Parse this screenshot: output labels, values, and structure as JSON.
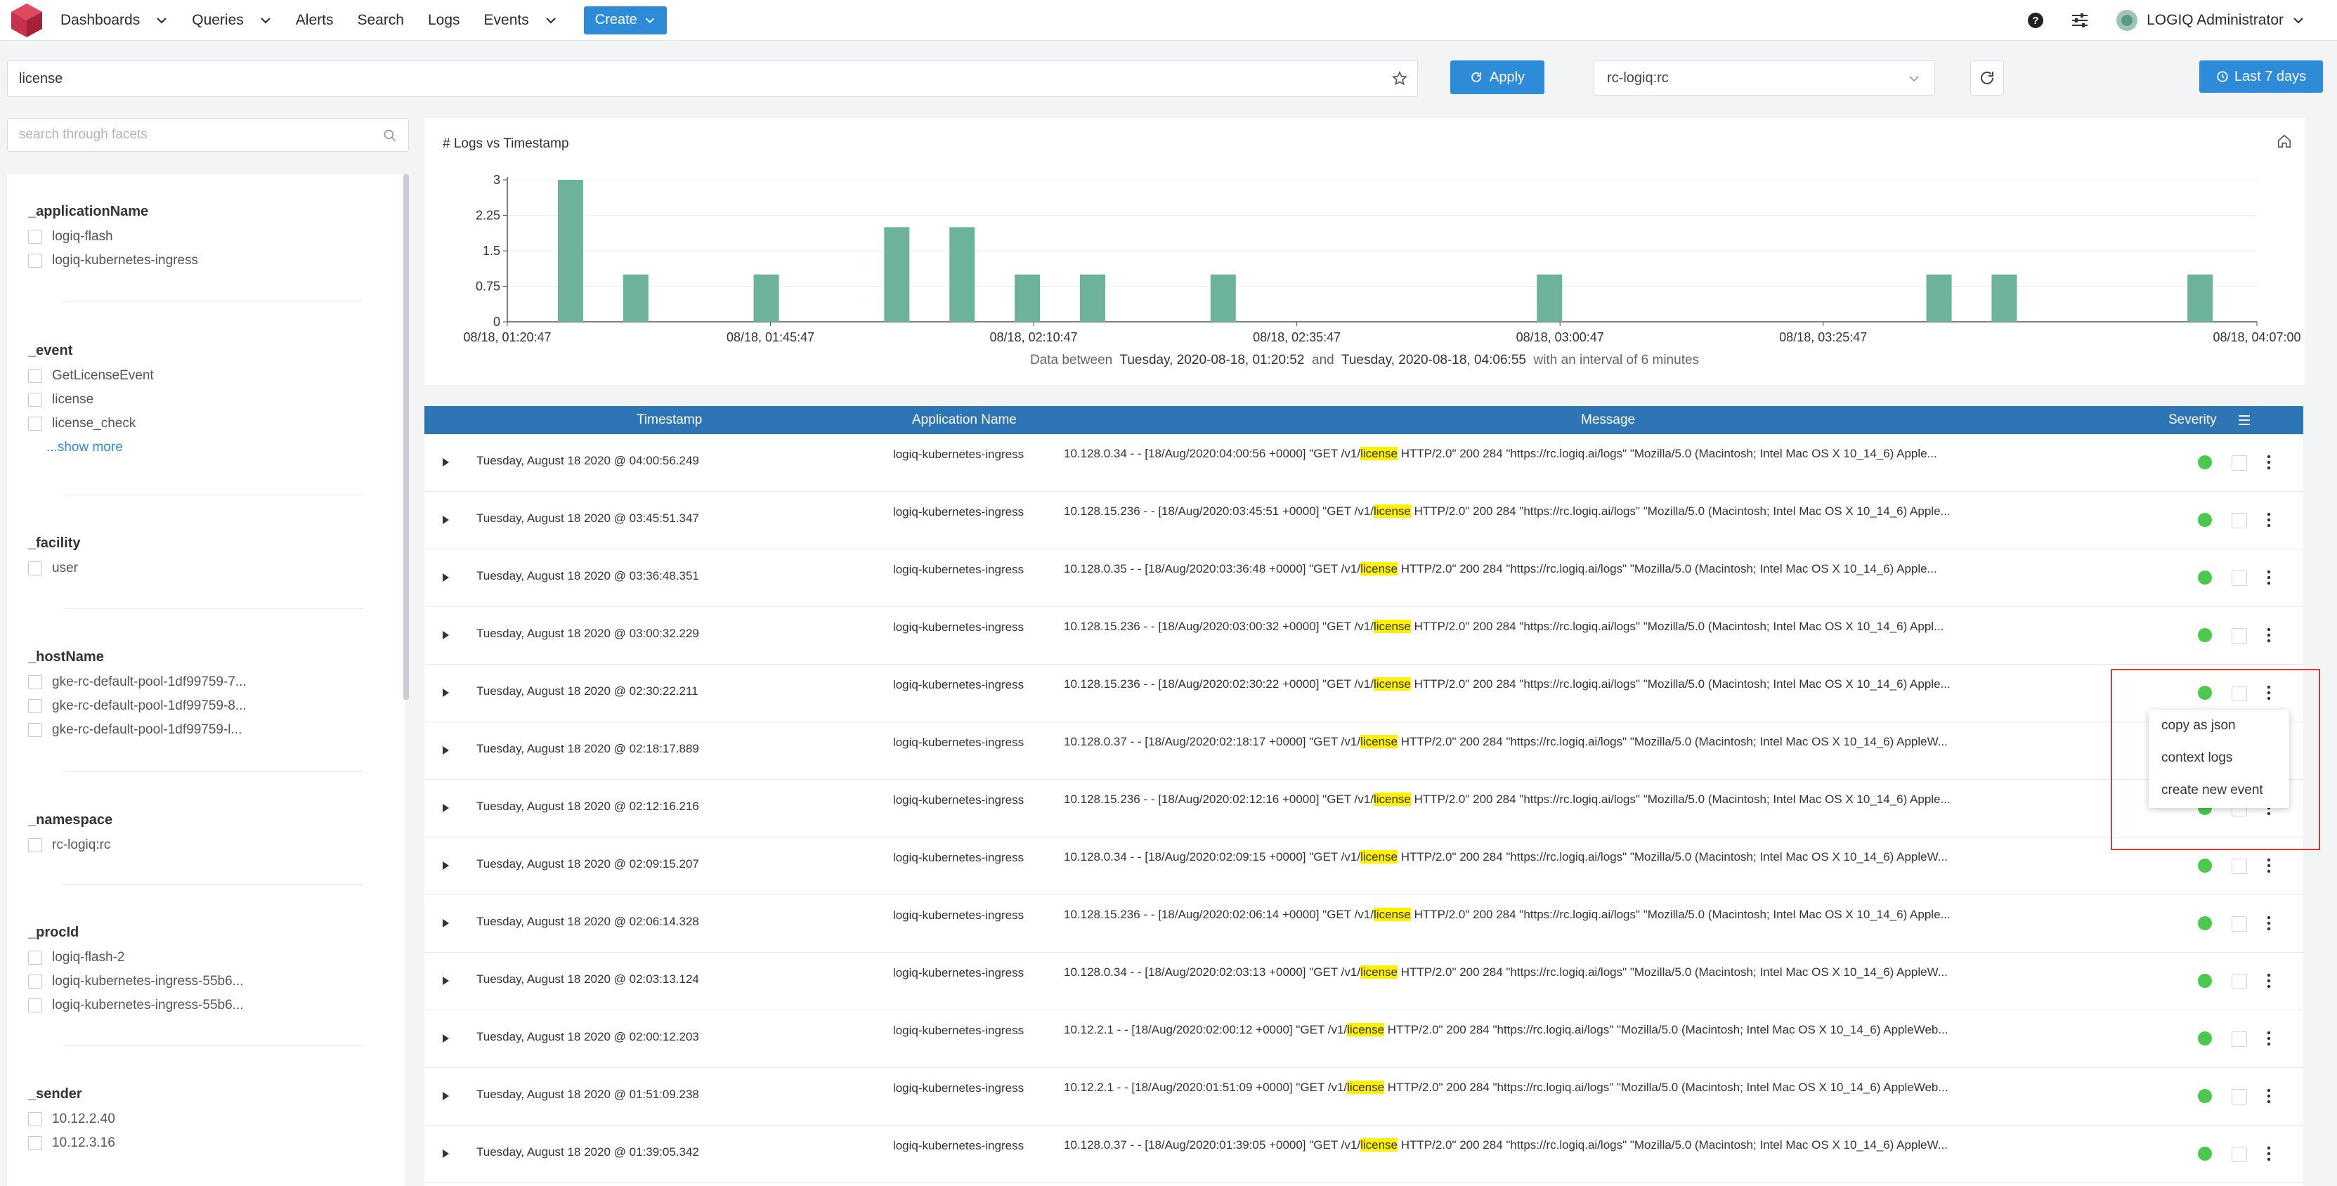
{
  "nav": {
    "items": [
      "Dashboards",
      "Queries",
      "Alerts",
      "Search",
      "Logs",
      "Events"
    ],
    "create_label": "Create",
    "user_label": "LOGIQ Administrator"
  },
  "query": {
    "text": "license",
    "apply_label": "Apply",
    "namespace": "rc-logiq:rc",
    "time_range": "Last 7 days"
  },
  "facets": {
    "search_placeholder": "search through facets",
    "groups": [
      {
        "title": "_applicationName",
        "options": [
          "logiq-flash",
          "logiq-kubernetes-ingress"
        ]
      },
      {
        "title": "_event",
        "options": [
          "GetLicenseEvent",
          "license",
          "license_check"
        ],
        "more": "...show more"
      },
      {
        "title": "_facility",
        "options": [
          "user"
        ]
      },
      {
        "title": "_hostName",
        "options": [
          "gke-rc-default-pool-1df99759-7...",
          "gke-rc-default-pool-1df99759-8...",
          "gke-rc-default-pool-1df99759-l..."
        ]
      },
      {
        "title": "_namespace",
        "options": [
          "rc-logiq:rc"
        ]
      },
      {
        "title": "_procId",
        "options": [
          "logiq-flash-2",
          "logiq-kubernetes-ingress-55b6...",
          "logiq-kubernetes-ingress-55b6..."
        ]
      },
      {
        "title": "_sender",
        "options": [
          "10.12.2.40",
          "10.12.3.16"
        ]
      }
    ]
  },
  "chart_data": {
    "type": "bar",
    "title": "# Logs vs Timestamp",
    "y_ticks": [
      "3",
      "2.25",
      "1.5",
      "0.75",
      "0"
    ],
    "ylim": [
      0,
      3
    ],
    "x_ticks": [
      "08/18, 01:20:47",
      "08/18, 01:45:47",
      "08/18, 02:10:47",
      "08/18, 02:35:47",
      "08/18, 03:00:47",
      "08/18, 03:25:47",
      "08/18, 04:07:00"
    ],
    "x_tick_minutes": [
      0,
      25,
      50,
      75,
      100,
      125,
      166.2
    ],
    "bars": [
      {
        "minute": 6,
        "value": 3
      },
      {
        "minute": 12.2,
        "value": 1
      },
      {
        "minute": 24.6,
        "value": 1
      },
      {
        "minute": 37,
        "value": 2
      },
      {
        "minute": 43.2,
        "value": 2
      },
      {
        "minute": 49.4,
        "value": 1
      },
      {
        "minute": 55.6,
        "value": 1
      },
      {
        "minute": 68,
        "value": 1
      },
      {
        "minute": 99,
        "value": 1
      },
      {
        "minute": 136,
        "value": 1
      },
      {
        "minute": 142.2,
        "value": 1
      },
      {
        "minute": 160.8,
        "value": 1
      }
    ],
    "caption_prefix": "Data between",
    "caption_start": "Tuesday, 2020-08-18, 01:20:52",
    "caption_and": "and",
    "caption_end": "Tuesday, 2020-08-18, 04:06:55",
    "caption_suffix": "with an interval of 6 minutes"
  },
  "table": {
    "headers": {
      "timestamp": "Timestamp",
      "app": "Application Name",
      "message": "Message",
      "severity": "Severity"
    },
    "highlight": "license",
    "rows": [
      {
        "ts": "Tuesday, August 18 2020 @ 04:00:56.249",
        "app": "logiq-kubernetes-ingress",
        "pre": "10.128.0.34 - - [18/Aug/2020:04:00:56 +0000] \"GET /v1/",
        "post": " HTTP/2.0\" 200 284 \"https://rc.logiq.ai/logs\" \"Mozilla/5.0 (Macintosh; Intel Mac OS X 10_14_6) Apple..."
      },
      {
        "ts": "Tuesday, August 18 2020 @ 03:45:51.347",
        "app": "logiq-kubernetes-ingress",
        "pre": "10.128.15.236 - - [18/Aug/2020:03:45:51 +0000] \"GET /v1/",
        "post": " HTTP/2.0\" 200 284 \"https://rc.logiq.ai/logs\" \"Mozilla/5.0 (Macintosh; Intel Mac OS X 10_14_6) Apple..."
      },
      {
        "ts": "Tuesday, August 18 2020 @ 03:36:48.351",
        "app": "logiq-kubernetes-ingress",
        "pre": "10.128.0.35 - - [18/Aug/2020:03:36:48 +0000] \"GET /v1/",
        "post": " HTTP/2.0\" 200 284 \"https://rc.logiq.ai/logs\" \"Mozilla/5.0 (Macintosh; Intel Mac OS X 10_14_6) Apple..."
      },
      {
        "ts": "Tuesday, August 18 2020 @ 03:00:32.229",
        "app": "logiq-kubernetes-ingress",
        "pre": "10.128.15.236 - - [18/Aug/2020:03:00:32 +0000] \"GET /v1/",
        "post": " HTTP/2.0\" 200 284 \"https://rc.logiq.ai/logs\" \"Mozilla/5.0 (Macintosh; Intel Mac OS X 10_14_6) Appl..."
      },
      {
        "ts": "Tuesday, August 18 2020 @ 02:30:22.211",
        "app": "logiq-kubernetes-ingress",
        "pre": "10.128.15.236 - - [18/Aug/2020:02:30:22 +0000] \"GET /v1/",
        "post": " HTTP/2.0\" 200 284 \"https://rc.logiq.ai/logs\" \"Mozilla/5.0 (Macintosh; Intel Mac OS X 10_14_6) Apple..."
      },
      {
        "ts": "Tuesday, August 18 2020 @ 02:18:17.889",
        "app": "logiq-kubernetes-ingress",
        "pre": "10.128.0.37 - - [18/Aug/2020:02:18:17 +0000] \"GET /v1/",
        "post": " HTTP/2.0\" 200 284 \"https://rc.logiq.ai/logs\" \"Mozilla/5.0 (Macintosh; Intel Mac OS X 10_14_6) AppleW..."
      },
      {
        "ts": "Tuesday, August 18 2020 @ 02:12:16.216",
        "app": "logiq-kubernetes-ingress",
        "pre": "10.128.15.236 - - [18/Aug/2020:02:12:16 +0000] \"GET /v1/",
        "post": " HTTP/2.0\" 200 284 \"https://rc.logiq.ai/logs\" \"Mozilla/5.0 (Macintosh; Intel Mac OS X 10_14_6) Apple..."
      },
      {
        "ts": "Tuesday, August 18 2020 @ 02:09:15.207",
        "app": "logiq-kubernetes-ingress",
        "pre": "10.128.0.34 - - [18/Aug/2020:02:09:15 +0000] \"GET /v1/",
        "post": " HTTP/2.0\" 200 284 \"https://rc.logiq.ai/logs\" \"Mozilla/5.0 (Macintosh; Intel Mac OS X 10_14_6) AppleW..."
      },
      {
        "ts": "Tuesday, August 18 2020 @ 02:06:14.328",
        "app": "logiq-kubernetes-ingress",
        "pre": "10.128.15.236 - - [18/Aug/2020:02:06:14 +0000] \"GET /v1/",
        "post": " HTTP/2.0\" 200 284 \"https://rc.logiq.ai/logs\" \"Mozilla/5.0 (Macintosh; Intel Mac OS X 10_14_6) Apple..."
      },
      {
        "ts": "Tuesday, August 18 2020 @ 02:03:13.124",
        "app": "logiq-kubernetes-ingress",
        "pre": "10.128.0.34 - - [18/Aug/2020:02:03:13 +0000] \"GET /v1/",
        "post": " HTTP/2.0\" 200 284 \"https://rc.logiq.ai/logs\" \"Mozilla/5.0 (Macintosh; Intel Mac OS X 10_14_6) AppleW..."
      },
      {
        "ts": "Tuesday, August 18 2020 @ 02:00:12.203",
        "app": "logiq-kubernetes-ingress",
        "pre": "10.12.2.1 - - [18/Aug/2020:02:00:12 +0000] \"GET /v1/",
        "post": " HTTP/2.0\" 200 284 \"https://rc.logiq.ai/logs\" \"Mozilla/5.0 (Macintosh; Intel Mac OS X 10_14_6) AppleWeb..."
      },
      {
        "ts": "Tuesday, August 18 2020 @ 01:51:09.238",
        "app": "logiq-kubernetes-ingress",
        "pre": "10.12.2.1 - - [18/Aug/2020:01:51:09 +0000] \"GET /v1/",
        "post": " HTTP/2.0\" 200 284 \"https://rc.logiq.ai/logs\" \"Mozilla/5.0 (Macintosh; Intel Mac OS X 10_14_6) AppleWeb..."
      },
      {
        "ts": "Tuesday, August 18 2020 @ 01:39:05.342",
        "app": "logiq-kubernetes-ingress",
        "pre": "10.128.0.37 - - [18/Aug/2020:01:39:05 +0000] \"GET /v1/",
        "post": " HTTP/2.0\" 200 284 \"https://rc.logiq.ai/logs\" \"Mozilla/5.0 (Macintosh; Intel Mac OS X 10_14_6) AppleW..."
      }
    ]
  },
  "context_menu": [
    "copy as json",
    "context logs",
    "create new event"
  ],
  "colors": {
    "accent": "#2d8bd8",
    "header": "#2e75b6",
    "bar": "#6db39b",
    "severity_ok": "#4cc94c",
    "highlight": "#fff200",
    "callout": "#e03a2f"
  },
  "icons": {
    "logo": "logiq-logo-icon",
    "help": "help-icon",
    "settings": "sliders-icon",
    "user": "user-avatar-icon",
    "star": "star-icon",
    "refresh": "refresh-icon",
    "clock": "clock-icon",
    "search": "search-icon",
    "home": "home-icon",
    "row_actions": "kebab-icon"
  }
}
